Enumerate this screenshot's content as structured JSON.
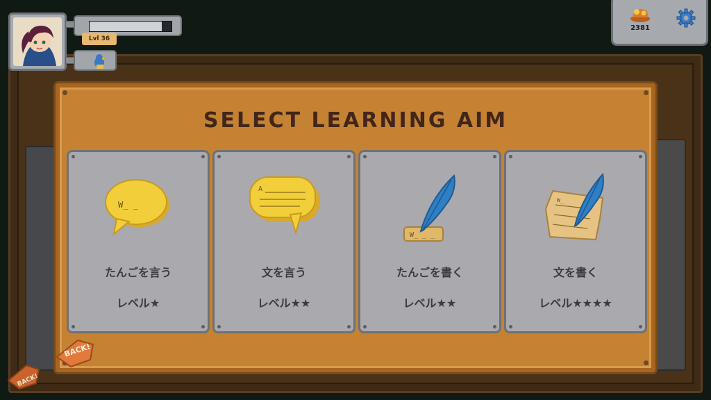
{
  "player": {
    "level_label": "Lvl 36",
    "xp_fraction": 0.88
  },
  "currency": {
    "amount": "2381",
    "icon": "treasure-coins-icon"
  },
  "modal": {
    "title": "SELECT LEARNING AIM",
    "cards": [
      {
        "label": "たんごを言う",
        "level": "レベル★",
        "icon": "speech-bubble-word-icon"
      },
      {
        "label": "文を言う",
        "level": "レベル★★",
        "icon": "speech-bubble-sentence-icon"
      },
      {
        "label": "たんごを書く",
        "level": "レベル★★",
        "icon": "quill-word-icon"
      },
      {
        "label": "文を書く",
        "level": "レベル★★★★",
        "icon": "quill-paper-icon"
      }
    ]
  },
  "back_label": "BACK!",
  "colors": {
    "modal_bg": "#c58233",
    "card_bg": "#a9a9ae",
    "title_text": "#43261a",
    "icon_yellow": "#f2cf3a",
    "quill_blue": "#2f7fc4"
  }
}
